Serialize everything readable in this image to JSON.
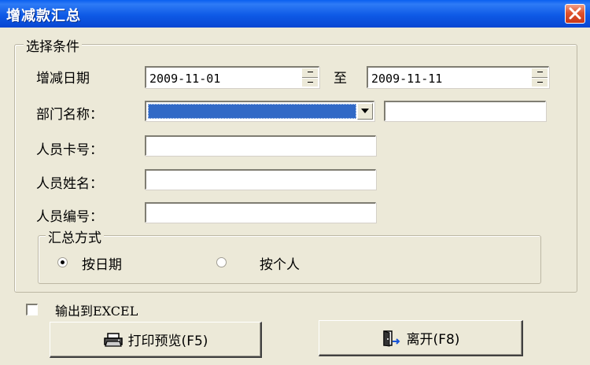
{
  "window": {
    "title": "增减款汇总"
  },
  "conditions": {
    "group_label": "选择条件",
    "date": {
      "label": "增减日期",
      "from": "2009-11-01",
      "to_label": "至",
      "to": "2009-11-11"
    },
    "department": {
      "label": "部门名称：",
      "selected": "",
      "extra": ""
    },
    "card_no": {
      "label": "人员卡号：",
      "value": ""
    },
    "name": {
      "label": "人员姓名：",
      "value": ""
    },
    "emp_no": {
      "label": "人员编号：",
      "value": ""
    },
    "summary_mode": {
      "group_label": "汇总方式",
      "options": [
        {
          "label": "按日期",
          "checked": true
        },
        {
          "label": "按个人",
          "checked": false
        }
      ]
    }
  },
  "export": {
    "label": "输出到EXCEL",
    "checked": false
  },
  "buttons": {
    "preview": {
      "label": "打印预览(F5)",
      "icon": "printer-icon"
    },
    "exit": {
      "label": "离开(F8)",
      "icon": "exit-door-icon"
    }
  },
  "colors": {
    "title_bar": "#0a5ff0",
    "selection": "#3169c6",
    "close": "#e0532c"
  }
}
